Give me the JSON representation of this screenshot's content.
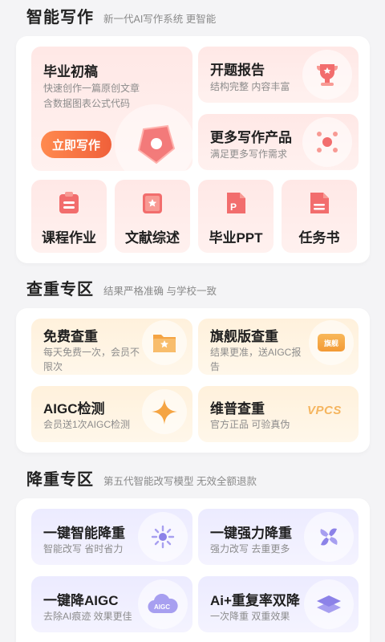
{
  "writing": {
    "title": "智能写作",
    "subtitle": "新一代AI写作系统 更智能",
    "main_card": {
      "title": "毕业初稿",
      "desc1": "快速创作一篇原创文章",
      "desc2": "含数据图表公式代码",
      "cta": "立即写作"
    },
    "cards": [
      {
        "title": "开题报告",
        "desc": "结构完整 内容丰富",
        "icon": "trophy-icon"
      },
      {
        "title": "更多写作产品",
        "desc": "满足更多写作需求",
        "icon": "grid-dots-icon"
      }
    ],
    "small_cards": [
      {
        "label": "课程作业",
        "icon": "clipboard-icon"
      },
      {
        "label": "文献综述",
        "icon": "book-star-icon"
      },
      {
        "label": "毕业PPT",
        "icon": "ppt-icon"
      },
      {
        "label": "任务书",
        "icon": "document-icon"
      }
    ]
  },
  "check": {
    "title": "查重专区",
    "subtitle": "结果严格准确 与学校一致",
    "cards": [
      {
        "title": "免费查重",
        "desc1": "每天免费一次，会员不",
        "desc2": "限次",
        "icon": "folder-star-icon"
      },
      {
        "title": "旗舰版查重",
        "desc1": "结果更准，送AIGC报",
        "desc2": "告",
        "icon": "flagship-badge-icon",
        "badge": "旗舰"
      },
      {
        "title": "AIGC检测",
        "desc1": "会员送1次AIGC检测",
        "desc2": "",
        "icon": "sparkle-icon"
      },
      {
        "title": "维普查重",
        "desc1": "官方正品 可验真伪",
        "desc2": "",
        "icon": "vpcs-logo-icon",
        "logo": "VPCS"
      }
    ]
  },
  "reduce": {
    "title": "降重专区",
    "subtitle": "第五代智能改写模型 无效全额退款",
    "cards": [
      {
        "title": "一键智能降重",
        "desc": "智能改写 省时省力",
        "icon": "burst-icon"
      },
      {
        "title": "一键强力降重",
        "desc": "强力改写 去重更多",
        "icon": "pinwheel-icon"
      },
      {
        "title": "一键降AIGC",
        "desc": "去除AI痕迹 效果更佳",
        "icon": "aigc-cloud-icon",
        "logo": "AIGC"
      },
      {
        "title": "Ai+重复率双降",
        "desc": "一次降重 双重效果",
        "icon": "layers-icon"
      }
    ]
  },
  "colors": {
    "accent": "#f0603a",
    "pink": "#ffe8e6",
    "cream": "#fff1dc",
    "lavender": "#ecebff",
    "icon_red": "#f26d6d",
    "icon_orange": "#f5a443",
    "icon_purple": "#8c82e8"
  }
}
